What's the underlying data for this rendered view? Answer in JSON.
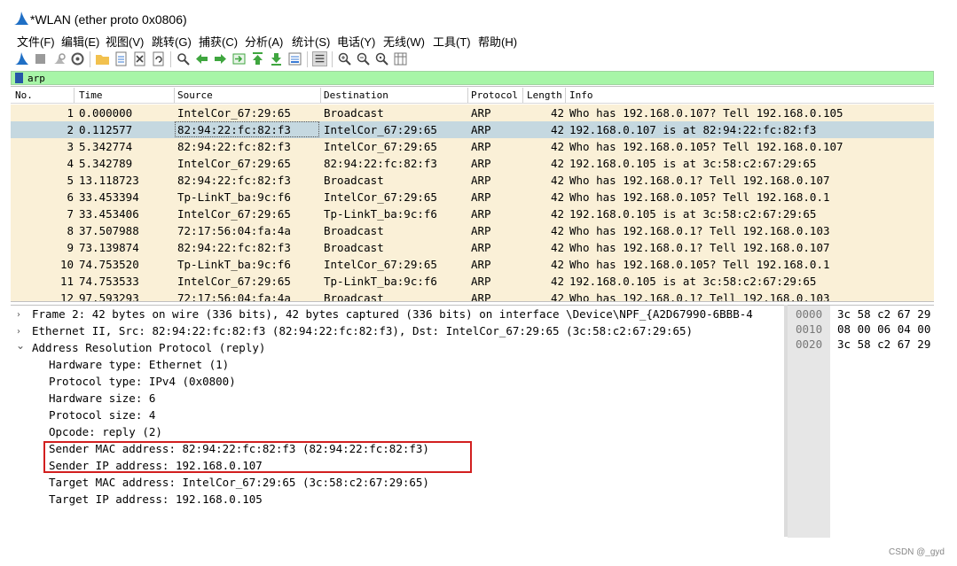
{
  "window": {
    "title": "*WLAN (ether proto 0x0806)"
  },
  "menu": [
    "文件(F)",
    "编辑(E)",
    "视图(V)",
    "跳转(G)",
    "捕获(C)",
    "分析(A)",
    "统计(S)",
    "电话(Y)",
    "无线(W)",
    "工具(T)",
    "帮助(H)"
  ],
  "toolbar": {
    "icons": [
      "shark-fin-icon",
      "stop-icon",
      "restart-icon",
      "options-icon",
      "open-icon",
      "save-icon",
      "close-file-icon",
      "reload-icon",
      "find-icon",
      "back-icon",
      "forward-icon",
      "goto-icon",
      "first-icon",
      "last-icon",
      "autoscroll-icon",
      "colorize-icon",
      "zoom-in-icon",
      "zoom-out-icon",
      "zoom-reset-icon",
      "resize-columns-icon"
    ]
  },
  "filter": {
    "value": "arp"
  },
  "packet_list": {
    "columns": [
      "No.",
      "Time",
      "Source",
      "Destination",
      "Protocol",
      "Length",
      "Info"
    ],
    "rows": [
      {
        "no": "1",
        "time": "0.000000",
        "source": "IntelCor_67:29:65",
        "destination": "Broadcast",
        "protocol": "ARP",
        "length": "42",
        "info": "Who has 192.168.0.107? Tell 192.168.0.105"
      },
      {
        "no": "2",
        "time": "0.112577",
        "source": "82:94:22:fc:82:f3",
        "destination": "IntelCor_67:29:65",
        "protocol": "ARP",
        "length": "42",
        "info": "192.168.0.107 is at 82:94:22:fc:82:f3"
      },
      {
        "no": "3",
        "time": "5.342774",
        "source": "82:94:22:fc:82:f3",
        "destination": "IntelCor_67:29:65",
        "protocol": "ARP",
        "length": "42",
        "info": "Who has 192.168.0.105? Tell 192.168.0.107"
      },
      {
        "no": "4",
        "time": "5.342789",
        "source": "IntelCor_67:29:65",
        "destination": "82:94:22:fc:82:f3",
        "protocol": "ARP",
        "length": "42",
        "info": "192.168.0.105 is at 3c:58:c2:67:29:65"
      },
      {
        "no": "5",
        "time": "13.118723",
        "source": "82:94:22:fc:82:f3",
        "destination": "Broadcast",
        "protocol": "ARP",
        "length": "42",
        "info": "Who has 192.168.0.1? Tell 192.168.0.107"
      },
      {
        "no": "6",
        "time": "33.453394",
        "source": "Tp-LinkT_ba:9c:f6",
        "destination": "IntelCor_67:29:65",
        "protocol": "ARP",
        "length": "42",
        "info": "Who has 192.168.0.105? Tell 192.168.0.1"
      },
      {
        "no": "7",
        "time": "33.453406",
        "source": "IntelCor_67:29:65",
        "destination": "Tp-LinkT_ba:9c:f6",
        "protocol": "ARP",
        "length": "42",
        "info": "192.168.0.105 is at 3c:58:c2:67:29:65"
      },
      {
        "no": "8",
        "time": "37.507988",
        "source": "72:17:56:04:fa:4a",
        "destination": "Broadcast",
        "protocol": "ARP",
        "length": "42",
        "info": "Who has 192.168.0.1? Tell 192.168.0.103"
      },
      {
        "no": "9",
        "time": "73.139874",
        "source": "82:94:22:fc:82:f3",
        "destination": "Broadcast",
        "protocol": "ARP",
        "length": "42",
        "info": "Who has 192.168.0.1? Tell 192.168.0.107"
      },
      {
        "no": "10",
        "time": "74.753520",
        "source": "Tp-LinkT_ba:9c:f6",
        "destination": "IntelCor_67:29:65",
        "protocol": "ARP",
        "length": "42",
        "info": "Who has 192.168.0.105? Tell 192.168.0.1"
      },
      {
        "no": "11",
        "time": "74.753533",
        "source": "IntelCor_67:29:65",
        "destination": "Tp-LinkT_ba:9c:f6",
        "protocol": "ARP",
        "length": "42",
        "info": "192.168.0.105 is at 3c:58:c2:67:29:65"
      },
      {
        "no": "12",
        "time": "97.593293",
        "source": "72:17:56:04:fa:4a",
        "destination": "Broadcast",
        "protocol": "ARP",
        "length": "42",
        "info": "Who has 192.168.0.1? Tell 192.168.0.103"
      }
    ],
    "selected_row": "2"
  },
  "details": {
    "frame": "Frame 2: 42 bytes on wire (336 bits), 42 bytes captured (336 bits) on interface \\Device\\NPF_{A2D67990-6BBB-4",
    "ethernet": "Ethernet II, Src: 82:94:22:fc:82:f3 (82:94:22:fc:82:f3), Dst: IntelCor_67:29:65 (3c:58:c2:67:29:65)",
    "arp": "Address Resolution Protocol (reply)",
    "arp_fields": [
      "Hardware type: Ethernet (1)",
      "Protocol type: IPv4 (0x0800)",
      "Hardware size: 6",
      "Protocol size: 4",
      "Opcode: reply (2)",
      "Sender MAC address: 82:94:22:fc:82:f3 (82:94:22:fc:82:f3)",
      "Sender IP address: 192.168.0.107",
      "Target MAC address: IntelCor_67:29:65 (3c:58:c2:67:29:65)",
      "Target IP address: 192.168.0.105"
    ],
    "arrows": {
      "collapsed": "›",
      "expanded": "⌄"
    }
  },
  "hex": {
    "offsets": [
      "0000",
      "0010",
      "0020"
    ],
    "bytes": [
      "3c 58 c2 67 29",
      "08 00 06 04 00",
      "3c 58 c2 67 29"
    ]
  },
  "watermark": "CSDN @_gyd",
  "colors": {
    "row_normal": "#faf0d7",
    "row_selected": "#c5d8e0",
    "filter_ok": "#a7f5a7",
    "highlight": "#d21f1f"
  }
}
